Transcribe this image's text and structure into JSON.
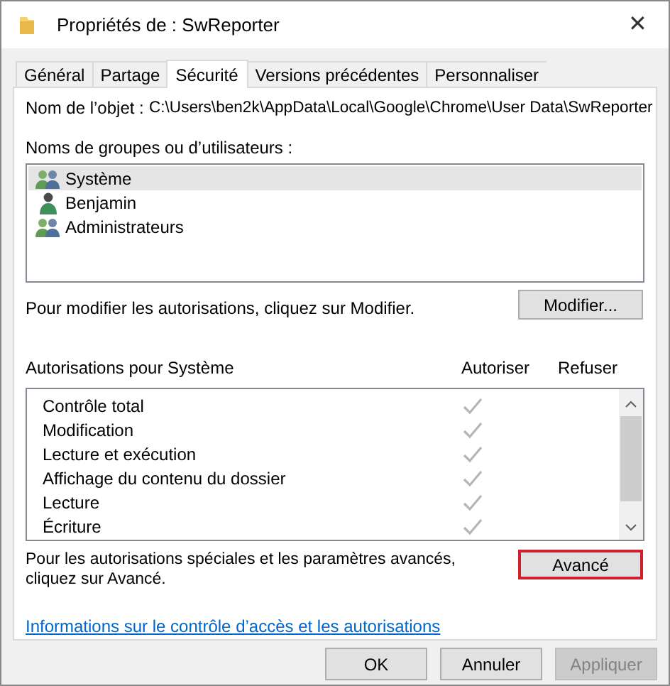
{
  "window": {
    "title": "Propriétés de : SwReporter",
    "close": "✕"
  },
  "tabs": [
    {
      "label": "Général",
      "selected": false
    },
    {
      "label": "Partage",
      "selected": false
    },
    {
      "label": "Sécurité",
      "selected": true
    },
    {
      "label": "Versions précédentes",
      "selected": false
    },
    {
      "label": "Personnaliser",
      "selected": false
    }
  ],
  "object_name": {
    "label": "Nom de l’objet :",
    "value": "C:\\Users\\ben2k\\AppData\\Local\\Google\\Chrome\\User Data\\SwReporter"
  },
  "users": {
    "label": "Noms de groupes ou d’utilisateurs :",
    "items": [
      {
        "name": "Système",
        "kind": "group",
        "selected": true
      },
      {
        "name": "Benjamin",
        "kind": "user",
        "selected": false
      },
      {
        "name": "Administrateurs",
        "kind": "group",
        "selected": false
      }
    ]
  },
  "edit_hint": "Pour modifier les autorisations, cliquez sur Modifier.",
  "edit_button": "Modifier...",
  "permissions": {
    "label": "Autorisations pour Système",
    "columns": [
      "Autoriser",
      "Refuser"
    ],
    "rows": [
      {
        "name": "Contrôle total",
        "allow": true,
        "deny": false
      },
      {
        "name": "Modification",
        "allow": true,
        "deny": false
      },
      {
        "name": "Lecture et exécution",
        "allow": true,
        "deny": false
      },
      {
        "name": "Affichage du contenu du dossier",
        "allow": true,
        "deny": false
      },
      {
        "name": "Lecture",
        "allow": true,
        "deny": false
      },
      {
        "name": "Écriture",
        "allow": true,
        "deny": false
      }
    ]
  },
  "advanced_hint": "Pour les autorisations spéciales et les paramètres avancés, cliquez sur Avancé.",
  "advanced_button": {
    "label": "Avancé",
    "highlighted": true
  },
  "help_link": "Informations sur le contrôle d’accès et les autorisations",
  "buttons": [
    {
      "label": "OK",
      "disabled": false
    },
    {
      "label": "Annuler",
      "disabled": false
    },
    {
      "label": "Appliquer",
      "disabled": true
    }
  ]
}
